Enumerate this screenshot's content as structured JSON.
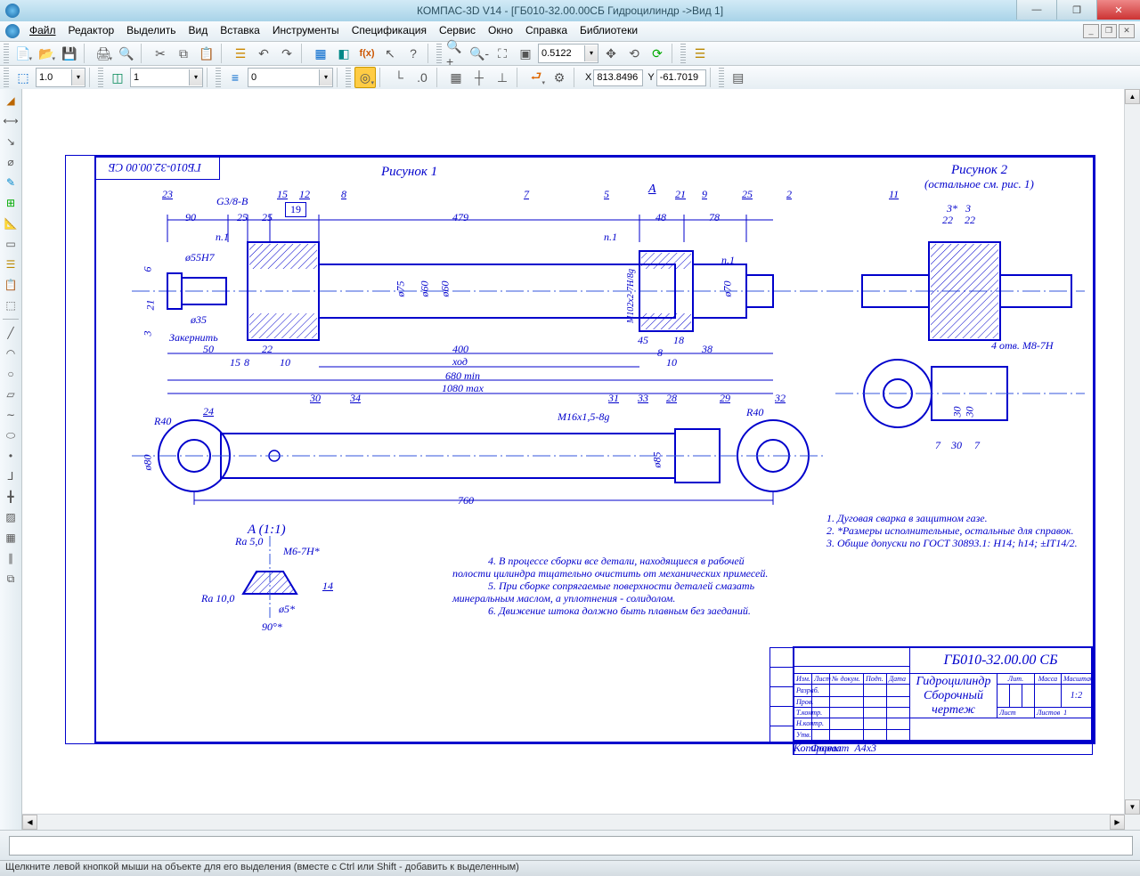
{
  "window": {
    "title": "КОМПАС-3D V14 - [ГБ010-32.00.00СБ Гидроцилиндр ->Вид 1]"
  },
  "menu": {
    "file": "Файл",
    "edit": "Редактор",
    "select": "Выделить",
    "view": "Вид",
    "insert": "Вставка",
    "tools": "Инструменты",
    "spec": "Спецификация",
    "service": "Сервис",
    "window": "Окно",
    "help": "Справка",
    "libs": "Библиотеки"
  },
  "tb2": {
    "zoom_value": "0.5122"
  },
  "tb3": {
    "scale": "1.0",
    "layer": "1",
    "style": "0",
    "x": "813.8496",
    "y": "-61.7019"
  },
  "drawing": {
    "fig1_title": "Рисунок 1",
    "fig2_title": "Рисунок 2",
    "fig2_sub": "(остальное см. рис. 1)",
    "detail_label": "A (1:1)",
    "dims": {
      "d90": "90",
      "d25a": "25",
      "d25b": "25",
      "d479": "479",
      "d48": "48",
      "d78": "78",
      "d6": "6",
      "d21": "21",
      "d3": "3",
      "d50": "50",
      "d15a": "15",
      "d8a": "8",
      "d22a": "22",
      "d10b": "10",
      "d400": "400",
      "hod": "ход",
      "d680": "680 min",
      "d1080": "1080 max",
      "d45": "45",
      "d8c": "8",
      "d18": "18",
      "d10c": "10",
      "d38": "38",
      "d760": "760",
      "r40a": "R40",
      "r40b": "R40",
      "d55h7": "ø55H7",
      "d35": "ø35",
      "d75": "ø75",
      "d60_1": "ø60",
      "d60_2": "ø60",
      "d102": "M102x2-7H/8g",
      "d70": "ø70",
      "d80": "ø80",
      "d85": "ø85",
      "g38": "G3/8-B",
      "m16": "M16x1,5-8g",
      "d3r": "3*",
      "d3rs": "3",
      "d22r": "22",
      "d22rs": "22",
      "d4m8": "4 отв. М8-7Н",
      "d30r": "30",
      "d30rs": "30",
      "d7r": "7",
      "d7rs": "7",
      "ra50": "Ra 5,0",
      "ra100": "Ra 10,0",
      "m6": "M6-7H*",
      "d5s": "ø5*",
      "ang90": "90°*",
      "zak": "Закернить"
    },
    "leaders": {
      "2": "2",
      "5": "5",
      "7": "7",
      "8": "8",
      "9": "9",
      "11": "11",
      "12": "12",
      "14": "14",
      "15": "15",
      "19": "19",
      "21": "21",
      "23": "23",
      "24": "24",
      "25a": "25",
      "25b": "25",
      "28": "28",
      "29": "29",
      "30": "30",
      "31": "31",
      "32": "32",
      "33": "33",
      "34": "34",
      "n1a": "n.1",
      "n1b": "n.1",
      "n1c": "n.1",
      "A": "А"
    },
    "notes": {
      "n1": "1. Дуговая сварка в защитном газе.",
      "n2": "2. *Размеры исполнительные, остальные для справок.",
      "n3": "3. Общие допуски по ГОСТ 30893.1: H14; h14; ±IT14/2.",
      "n4": "4. В процессе сборки все детали, находящиеся в рабочей",
      "n4b": "полости цилиндра тщательно очистить от механических примесей.",
      "n5": "5. При сборке сопрягаемые поверхности деталей смазать",
      "n5b": "минеральным маслом, а уплотнения - солидолом.",
      "n6": "6. Движение штока должно быть плавным без заеданий."
    },
    "titleblock": {
      "designation": "ГБ010-32.00.00 СБ",
      "name1": "Гидроцилиндр",
      "name2": "Сборочный чертеж",
      "kopiroval": "Копировал",
      "format": "Формат",
      "format_v": "А4х3",
      "lit": "Лит.",
      "mass": "Масса",
      "scale_h": "Масштаб",
      "scale_v": "1:2",
      "sheet": "Лист",
      "sheets": "Листов",
      "sheets_v": "1",
      "izm": "Изм.",
      "list": "Лист",
      "ndoc": "№ докум.",
      "podp": "Подп.",
      "data": "Дата",
      "razrab": "Разраб.",
      "prov": "Пров.",
      "tkontr": "Т.контр.",
      "nkontr": "Н.контр.",
      "utv": "Утв.",
      "sidecode": "ГБ010-32.00.00 СБ"
    }
  },
  "status": {
    "hint": "Щелкните левой кнопкой мыши на объекте для его выделения (вместе с Ctrl или Shift - добавить к выделенным)"
  }
}
